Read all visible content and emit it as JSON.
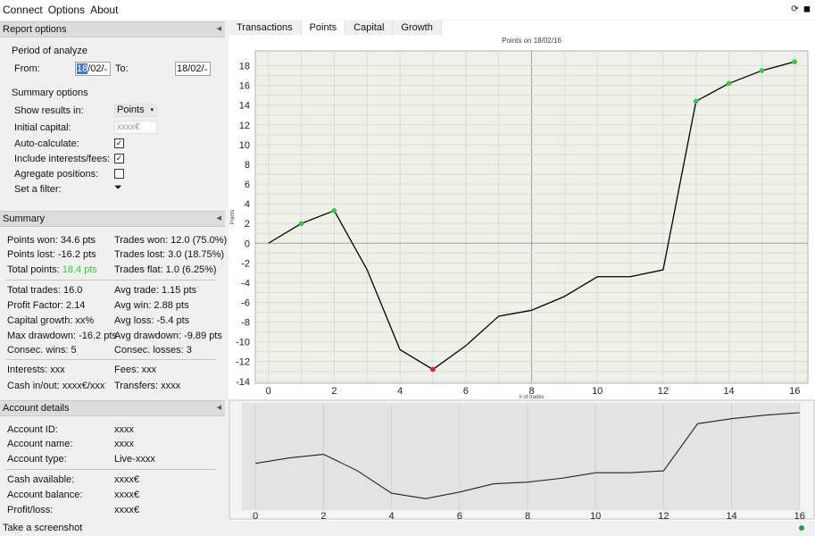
{
  "menu": [
    "Connect",
    "Options",
    "About"
  ],
  "report_options": {
    "title": "Report options",
    "period_label": "Period of analyze",
    "from_label": "From:",
    "from_value_selected": "18",
    "from_value_rest": "/02/",
    "to_label": "To:",
    "to_value": "18/02/",
    "summary_options_label": "Summary options",
    "show_results_label": "Show results in:",
    "show_results_value": "Points",
    "initial_capital_label": "Initial capital:",
    "initial_capital_placeholder": "xxxx€",
    "auto_calc_label": "Auto-calculate:",
    "include_interests_label": "Include interests/fees:",
    "aggregate_label": "Agregate positions:",
    "filter_label": "Set a filter:"
  },
  "summary": {
    "title": "Summary",
    "points_won": "Points won: 34.6 pts",
    "trades_won": "Trades won: 12.0 (75.0%)",
    "points_lost": "Points lost: -16.2 pts",
    "trades_lost": "Trades lost: 3.0 (18.75%)",
    "total_points_label": "Total points:",
    "total_points_value": "18.4 pts",
    "trades_flat": "Trades flat: 1.0 (6.25%)",
    "total_trades": "Total trades: 16.0",
    "avg_trade": "Avg trade: 1.15 pts",
    "profit_factor": "Profit Factor: 2.14",
    "avg_win": "Avg win: 2.88 pts",
    "capital_growth": "Capital growth: xx%",
    "avg_loss": "Avg loss: -5.4 pts",
    "max_drawdown": "Max drawdown: -16.2 pts",
    "avg_drawdown": "Avg drawdown: -9.89 pts",
    "consec_wins": "Consec. wins: 5",
    "consec_losses": "Consec. losses: 3",
    "interests": "Interests: xxx",
    "fees": "Fees: xxx",
    "cash_inout": "Cash in/out: xxxx€/xxx",
    "transfers": "Transfers: xxxx"
  },
  "account": {
    "title": "Account details",
    "id_label": "Account ID:",
    "id_value": "xxxx",
    "name_label": "Account name:",
    "name_value": "xxxx",
    "type_label": "Account type:",
    "type_value": "Live-xxxx",
    "cash_label": "Cash available:",
    "cash_value": "xxxx€",
    "balance_label": "Account balance:",
    "balance_value": "xxxx€",
    "pl_label": "Profit/loss:",
    "pl_value": "xxxx€"
  },
  "tabs": [
    "Transactions",
    "Points",
    "Capital",
    "Growth"
  ],
  "status": {
    "text": "Take a screenshot"
  },
  "colors": {
    "accent_green": "#2ecc40",
    "accent_red": "#e02020",
    "line": "#000000"
  },
  "chart_data": [
    {
      "type": "line",
      "title": "Points on 18/02/16",
      "xlabel": "# of trades",
      "ylabel": "Points",
      "xlim": [
        -0.4,
        16.4
      ],
      "ylim": [
        -14.2,
        19.5
      ],
      "xticks": [
        0,
        2,
        4,
        6,
        8,
        10,
        12,
        14,
        16
      ],
      "yticks": [
        -14,
        -12,
        -10,
        -8,
        -6,
        -4,
        -2,
        0,
        2,
        4,
        6,
        8,
        10,
        12,
        14,
        16,
        18
      ],
      "grid": true,
      "x": [
        0,
        1,
        2,
        3,
        4,
        5,
        6,
        7,
        8,
        9,
        10,
        11,
        12,
        13,
        14,
        15,
        16
      ],
      "y": [
        0,
        2.0,
        3.3,
        -2.7,
        -10.8,
        -12.8,
        -10.4,
        -7.4,
        -6.8,
        -5.4,
        -3.4,
        -3.4,
        -2.7,
        14.4,
        16.2,
        17.5,
        18.4
      ],
      "green_points": [
        1,
        2,
        13,
        14,
        15,
        16
      ],
      "red_points": [
        5
      ]
    },
    {
      "type": "line",
      "title": "",
      "xticks": [
        0,
        2,
        4,
        6,
        8,
        10,
        12,
        14,
        16
      ],
      "xlim": [
        -0.4,
        16.4
      ],
      "ylim": [
        -15,
        20
      ],
      "x": [
        0,
        1,
        2,
        3,
        4,
        5,
        6,
        7,
        8,
        9,
        10,
        11,
        12,
        13,
        14,
        15,
        16
      ],
      "y": [
        0,
        2.0,
        3.3,
        -2.7,
        -10.8,
        -12.8,
        -10.4,
        -7.4,
        -6.8,
        -5.4,
        -3.4,
        -3.4,
        -2.7,
        14.4,
        16.2,
        17.5,
        18.4
      ]
    }
  ]
}
